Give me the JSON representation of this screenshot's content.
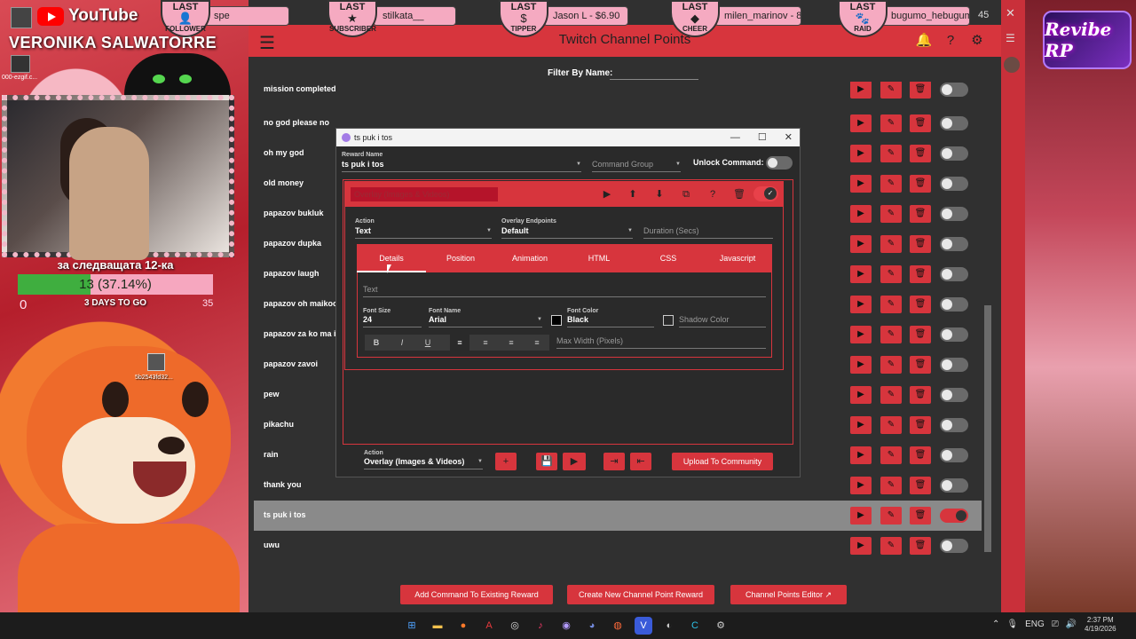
{
  "stream": {
    "youtube_label": "YouTube",
    "streamer_name": "VERONIKA SALWATORRE",
    "gif_label": "000-ezgif.c...",
    "goal_title": "за следващата 12-ка",
    "goal_progress_text": "13 (37.14%)",
    "goal_progress_fraction": 0.3714,
    "goal_min": "0",
    "goal_max": "35",
    "goal_days": "3 DAYS TO GO",
    "desktop_file_label": "5b2543fd32...",
    "brand_logo": "Revibe RP"
  },
  "alerts": [
    {
      "title": "LAST",
      "subtitle": "FOLLOWER",
      "icon": "person-plus-icon",
      "glyph": "👤",
      "value": "spe"
    },
    {
      "title": "LAST",
      "subtitle": "SUBSCRIBER",
      "icon": "star-icon",
      "glyph": "★",
      "value": "stilkata__"
    },
    {
      "title": "LAST",
      "subtitle": "TIPPER",
      "icon": "dollar-icon",
      "glyph": "$",
      "value": "Jason L - $6.90"
    },
    {
      "title": "LAST",
      "subtitle": "CHEER",
      "icon": "diamond-icon",
      "glyph": "◆",
      "value": "milen_marinov - 80"
    },
    {
      "title": "LAST",
      "subtitle": "RAID",
      "icon": "paw-icon",
      "glyph": "🐾",
      "value": "bugumo_hebugum"
    }
  ],
  "alert_extra": "45",
  "app": {
    "title": "Twitch Channel Points",
    "filter_label": "Filter By Name:",
    "filter_value": "",
    "header_icons": [
      "bell-icon",
      "help-icon",
      "gear-icon"
    ],
    "rows": [
      {
        "label": "mission completed",
        "enabled": false
      },
      {
        "label": "no god please no",
        "enabled": false
      },
      {
        "label": "oh my god",
        "enabled": false
      },
      {
        "label": "old money",
        "enabled": false
      },
      {
        "label": "papazov bukluk",
        "enabled": false
      },
      {
        "label": "papazov dupka",
        "enabled": false
      },
      {
        "label": "papazov laugh",
        "enabled": false
      },
      {
        "label": "papazov oh maikoooo",
        "enabled": false
      },
      {
        "label": "papazov za ko ma izp",
        "enabled": false
      },
      {
        "label": "papazov zavoi",
        "enabled": false
      },
      {
        "label": "pew",
        "enabled": false
      },
      {
        "label": "pikachu",
        "enabled": false
      },
      {
        "label": "rain",
        "enabled": false
      },
      {
        "label": "thank you",
        "enabled": false
      },
      {
        "label": "ts puk i tos",
        "enabled": true,
        "selected": true
      },
      {
        "label": "uwu",
        "enabled": false
      }
    ],
    "bottom_buttons": [
      "Add Command To Existing Reward",
      "Create New Channel Point Reward",
      "Channel Points Editor"
    ]
  },
  "dialog": {
    "window_title": "ts puk i tos",
    "reward_name_label": "Reward Name",
    "reward_name_value": "ts puk i tos",
    "command_group_placeholder": "Command Group",
    "unlock_label": "Unlock Command:",
    "action_card": {
      "title": "Overlay (Images & Videos)",
      "action_label": "Action",
      "action_value": "Text",
      "endpoints_label": "Overlay Endpoints",
      "endpoints_value": "Default",
      "duration_placeholder": "Duration (Secs)",
      "tabs": [
        "Details",
        "Position",
        "Animation",
        "HTML",
        "CSS",
        "Javascript"
      ],
      "active_tab": "Details",
      "text_placeholder": "Text",
      "font_size_label": "Font Size",
      "font_size_value": "24",
      "font_name_label": "Font Name",
      "font_name_value": "Arial",
      "font_color_label": "Font Color",
      "font_color_value": "Black",
      "shadow_color_placeholder": "Shadow Color",
      "max_width_placeholder": "Max Width (Pixels)"
    },
    "footer": {
      "action_label": "Action",
      "action_value": "Overlay (Images & Videos)",
      "upload_label": "Upload To Community"
    }
  },
  "taskbar": {
    "lang": "ENG",
    "time": "2:37 PM",
    "date": "4/19/2026"
  },
  "colors": {
    "accent": "#d7353d",
    "panel": "#303030",
    "selected_row": "#8a8a8a"
  }
}
